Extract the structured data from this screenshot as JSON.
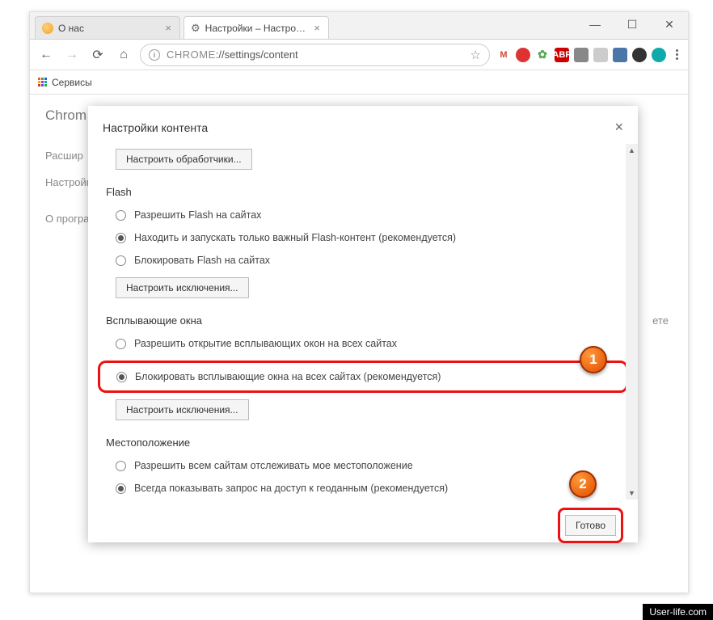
{
  "window": {
    "min": "—",
    "max": "☐",
    "close": "✕"
  },
  "tabs": [
    {
      "title": "О нас",
      "favicon": "orange"
    },
    {
      "title": "Настройки – Настройки",
      "favicon": "gear"
    }
  ],
  "addressBar": {
    "url_prefix": "CHROME",
    "url_rest": "://settings/content"
  },
  "bookmarks": {
    "services": "Сервисы"
  },
  "background": {
    "chrome": "Chrom",
    "nav": [
      "Расшир",
      "Настройк",
      "О програм"
    ],
    "truncated": "ете"
  },
  "modal": {
    "title": "Настройки контента",
    "close": "×",
    "handlers_btn": "Настроить обработчики...",
    "exceptions_btn": "Настроить исключения...",
    "done": "Готово",
    "flash": {
      "title": "Flash",
      "opt1": "Разрешить Flash на сайтах",
      "opt2": "Находить и запускать только важный Flash-контент (рекомендуется)",
      "opt3": "Блокировать Flash на сайтах"
    },
    "popups": {
      "title": "Всплывающие окна",
      "opt1": "Разрешить открытие всплывающих окон на всех сайтах",
      "opt2": "Блокировать всплывающие окна на всех сайтах (рекомендуется)"
    },
    "location": {
      "title": "Местоположение",
      "opt1": "Разрешить всем сайтам отслеживать мое местоположение",
      "opt2": "Всегда показывать запрос на доступ к геоданным (рекомендуется)"
    },
    "badge1": "1",
    "badge2": "2"
  },
  "watermark": "User-life.com"
}
